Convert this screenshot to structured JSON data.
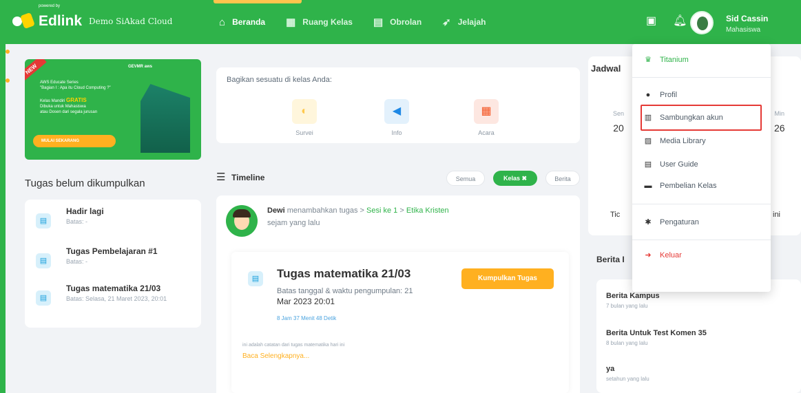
{
  "header": {
    "brand_tag": "powered by",
    "brand_name": "Edlink",
    "brand_sub": "Demo SiAkad Cloud",
    "nav": [
      {
        "label": "Beranda",
        "icon": "home-icon"
      },
      {
        "label": "Ruang Kelas",
        "icon": "classroom-icon"
      },
      {
        "label": "Obrolan",
        "icon": "chat-icon"
      },
      {
        "label": "Jelajah",
        "icon": "rocket-icon"
      }
    ],
    "user_name": "Sid Cassin",
    "user_role": "Mahasiswa"
  },
  "promo": {
    "ribbon": "NEW",
    "logos": "GEVMR  aws",
    "line1": "AWS Educate Series",
    "line2": "\"Bagian I : Apa itu Cloud Computing ?\"",
    "line3": "Kelas Mandiri",
    "gratis": "GRATIS",
    "line4": "Dibuka untuk Mahasiswa",
    "line5": "atau Dosen dari segala jurusan",
    "cta": "MULAI SEKARANG"
  },
  "tasks": {
    "title": "Tugas belum dikumpulkan",
    "items": [
      {
        "name": "Hadir lagi",
        "due": "Batas: -"
      },
      {
        "name": "Tugas Pembelajaran #1",
        "due": "Batas: -"
      },
      {
        "name": "Tugas matematika 21/03",
        "due": "Batas: Selasa, 21 Maret 2023, 20:01"
      }
    ]
  },
  "share": {
    "label": "Bagikan sesuatu di kelas Anda:",
    "options": [
      {
        "label": "Survei",
        "icon": "survey-icon",
        "color": "#ffc94d",
        "bg": "#fff6dc"
      },
      {
        "label": "Info",
        "icon": "megaphone-icon",
        "color": "#1e88e5",
        "bg": "#e3f1fc"
      },
      {
        "label": "Acara",
        "icon": "calendar-icon",
        "color": "#f4511e",
        "bg": "#fde7e1"
      }
    ]
  },
  "timeline": {
    "title": "Timeline",
    "filters": [
      "Semua",
      "Kelas ✖",
      "Berita"
    ]
  },
  "post": {
    "author": "Dewi",
    "action": "menambahkan tugas",
    "path1": "Sesi ke 1",
    "path2": "Etika Kristen",
    "sep": ">",
    "time": "sejam yang lalu",
    "assignment": {
      "title": "Tugas matematika 21/03",
      "deadline_label": "Batas tanggal & waktu pengumpulan: 21",
      "deadline_value": "Mar 2023 20:01",
      "countdown": "8 Jam 37 Menit 48 Detik",
      "submit": "Kumpulkan Tugas",
      "note": "ini adalah catatan dari tugas matematika hari ini",
      "more": "Baca Selengkapnya..."
    }
  },
  "jadwal": {
    "title": "Jadwal",
    "day_left": {
      "name": "Sen",
      "date": "20"
    },
    "day_right": {
      "name": "Min",
      "date": "26"
    },
    "text_left": "Tic",
    "text_right": "ini"
  },
  "berita": {
    "title": "Berita I",
    "items": [
      {
        "title": "Berita Kampus",
        "time": "7 bulan yang lalu"
      },
      {
        "title": "Berita Untuk Test Komen 35",
        "time": "8 bulan yang lalu"
      },
      {
        "title": "ya",
        "time": "setahun yang lalu"
      }
    ]
  },
  "dropdown": {
    "titanium": "Titanium",
    "items": [
      {
        "label": "Profil",
        "icon": "user-icon"
      },
      {
        "label": "Sambungkan akun",
        "icon": "link-account-icon"
      },
      {
        "label": "Media Library",
        "icon": "media-icon"
      },
      {
        "label": "User Guide",
        "icon": "guide-icon"
      },
      {
        "label": "Pembelian Kelas",
        "icon": "purchase-icon"
      }
    ],
    "settings": "Pengaturan",
    "logout": "Keluar"
  },
  "colors": {
    "brand": "#2fb34a",
    "accent": "#ffb020",
    "danger": "#e53935"
  }
}
